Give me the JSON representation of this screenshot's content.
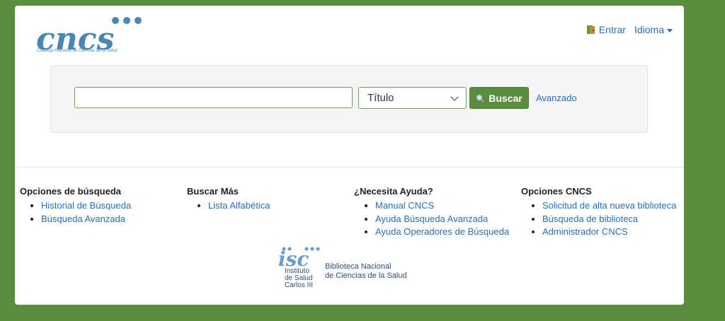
{
  "header": {
    "logo_text": "cncs",
    "logo_subtitle": "Catálogo Nacional de Ciencias de la Salud",
    "login_label": "Entrar",
    "language_label": "Idioma"
  },
  "search": {
    "input_value": "",
    "field_selected": "Título",
    "search_button": "Buscar",
    "advanced_link": "Avanzado"
  },
  "footer": {
    "columns": [
      {
        "title": "Opciones de búsqueda",
        "items": [
          "Historial de Búsqueda",
          "Búsqueda Avanzada"
        ]
      },
      {
        "title": "Buscar Más",
        "items": [
          "Lista Alfabética"
        ]
      },
      {
        "title": "¿Necesita Ayuda?",
        "items": [
          "Manual CNCS",
          "Ayuda Búsqueda Avanzada",
          "Ayuda Operadores de Búsqueda"
        ]
      },
      {
        "title": "Opciones CNCS",
        "items": [
          "Solicitud de alta nueva biblioteca",
          "Búsqueda de biblioteca",
          "Administrador CNCS"
        ]
      }
    ],
    "institute_lines": [
      "Instituto",
      "de Salud",
      "Carlos III"
    ],
    "library_lines": [
      "Biblioteca Nacional",
      "de Ciencias de la Salud"
    ]
  },
  "colors": {
    "brand_green": "#5b8c3e",
    "link_blue": "#2a6fb0",
    "logo_blue": "#4a86b4"
  }
}
